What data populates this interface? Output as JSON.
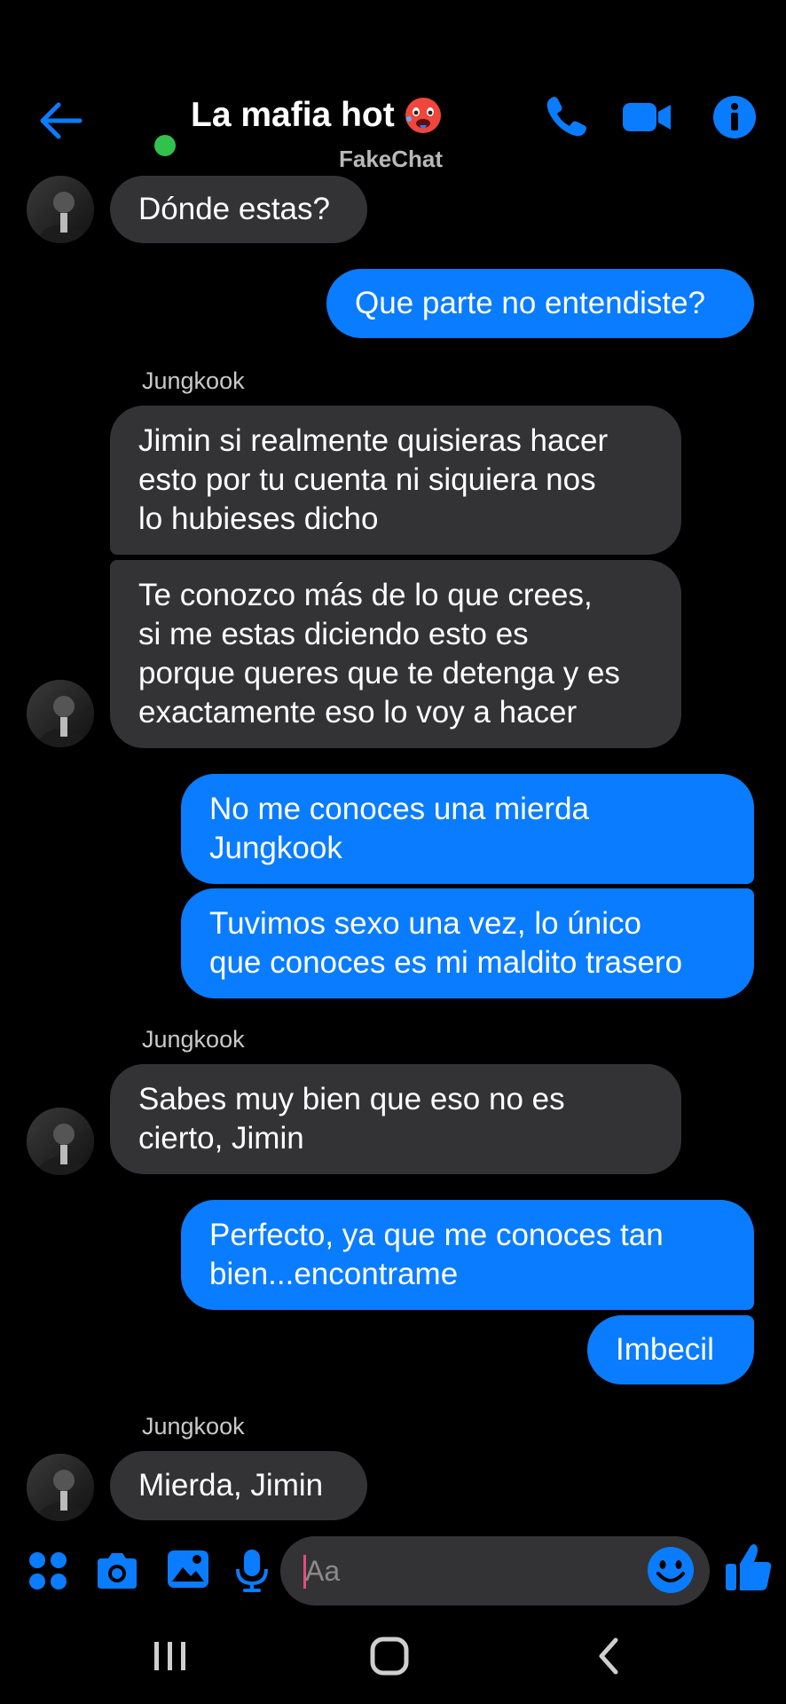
{
  "header": {
    "title": "La mafia hot",
    "title_emoji": "hot-face-emoji",
    "watermark": "FakeChat",
    "online_color": "#31c24d",
    "accent": "#0a7cff"
  },
  "messages": [
    {
      "from": "them",
      "lines": [
        "Dónde estas?"
      ]
    },
    {
      "from": "me",
      "lines": [
        "Que parte no entendiste?"
      ]
    },
    {
      "sender": "Jungkook"
    },
    {
      "from": "them",
      "lines": [
        "Jimin si realmente quisieras hacer",
        "esto por tu cuenta ni siquiera nos",
        "lo hubieses dicho"
      ]
    },
    {
      "from": "them",
      "lines": [
        "Te conozco más de lo que crees,",
        "si me estas diciendo esto es",
        "porque queres que te detenga y es",
        "exactamente eso lo voy a hacer"
      ]
    },
    {
      "from": "me",
      "lines": [
        "No me conoces una mierda",
        "Jungkook"
      ]
    },
    {
      "from": "me",
      "lines": [
        "Tuvimos sexo una vez, lo único",
        "que conoces es mi maldito trasero"
      ]
    },
    {
      "sender": "Jungkook"
    },
    {
      "from": "them",
      "lines": [
        "Sabes muy bien que eso no es",
        "cierto, Jimin"
      ]
    },
    {
      "from": "me",
      "lines": [
        "Perfecto, ya que me conoces tan",
        "bien...encontrame"
      ]
    },
    {
      "from": "me",
      "lines": [
        "Imbecil"
      ]
    },
    {
      "sender": "Jungkook"
    },
    {
      "from": "them",
      "lines": [
        "Mierda, Jimin"
      ]
    }
  ],
  "composer": {
    "placeholder": "Aa",
    "icons": [
      "apps-icon",
      "camera-icon",
      "gallery-icon",
      "microphone-icon",
      "emoji-icon",
      "like-icon"
    ]
  }
}
